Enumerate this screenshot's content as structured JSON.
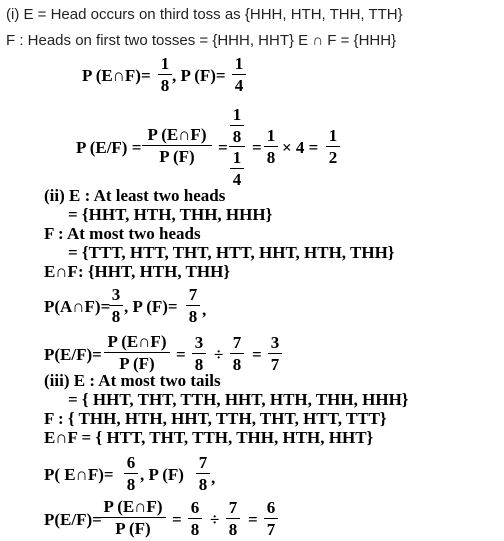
{
  "part1": {
    "line_e": "(i) E = Head occurs on third toss as {HHH, HTH, THH, TTH}",
    "line_f": "F : Heads on first two tosses = {HHH, HHT} E ∩ F = {HHH}",
    "p_ef_label": "P (E∩F)=",
    "p_ef_num": "1",
    "p_ef_den": "8",
    "p_f_label": ", P (F)=",
    "p_f_num": "1",
    "p_f_den": "4",
    "cond_label": "P (E/F) =",
    "cond_num": "P (E∩F)",
    "cond_den": "P (F)",
    "cond_eq1": "=",
    "cond_big_num_num": "1",
    "cond_big_num_den": "8",
    "cond_big_den_num": "1",
    "cond_big_den_den": "4",
    "cond_eq2": "=",
    "cond_f3_num": "1",
    "cond_f3_den": "8",
    "cond_times": "× 4 =",
    "cond_res_num": "1",
    "cond_res_den": "2"
  },
  "part2": {
    "e_line": "(ii) E : At least two heads",
    "e_set": "= {HHT, HTH, THH, HHH}",
    "f_line": "F : At most two heads",
    "f_set": "= {TTT, HTT, THT, HTT, HHT, HTH, THH}",
    "ef_line": "E∩F: {HHT, HTH, THH}",
    "p_af_label": "P(A∩F)=",
    "p_af_num": "3",
    "p_af_den": "8",
    "p_f_label": ", P (F)=",
    "p_f_num": "7",
    "p_f_den": "8",
    "p_f_tail": ",",
    "cond_label": "P(E/F)=",
    "cond_num": "P (E∩F)",
    "cond_den": "P (F)",
    "eq1": "=",
    "f1_num": "3",
    "f1_den": "8",
    "div": "÷",
    "f2_num": "7",
    "f2_den": "8",
    "eq2": "=",
    "res_num": "3",
    "res_den": "7"
  },
  "part3": {
    "e_line": "(iii) E : At most two tails",
    "e_set": "= { HHT, THT, TTH, HHT, HTH, THH, HHH}",
    "f_line": "F : { THH, HTH, HHT, TTH, THT, HTT, TTT}",
    "ef_line": "E∩F = { HTT, THT, TTH, THH, HTH, HHT}",
    "p_ef_label": "P( E∩F)=",
    "p_ef_num": "6",
    "p_ef_den": "8",
    "p_f_label": ", P (F)",
    "p_f_num": "7",
    "p_f_den": "8",
    "p_f_tail": ",",
    "cond_label": "P(E/F)=",
    "cond_num": "P (E∩F)",
    "cond_den": "P (F)",
    "eq1": "=",
    "f1_num": "6",
    "f1_den": "8",
    "div": "÷",
    "f2_num": "7",
    "f2_den": "8",
    "eq2": "=",
    "res_num": "6",
    "res_den": "7"
  }
}
